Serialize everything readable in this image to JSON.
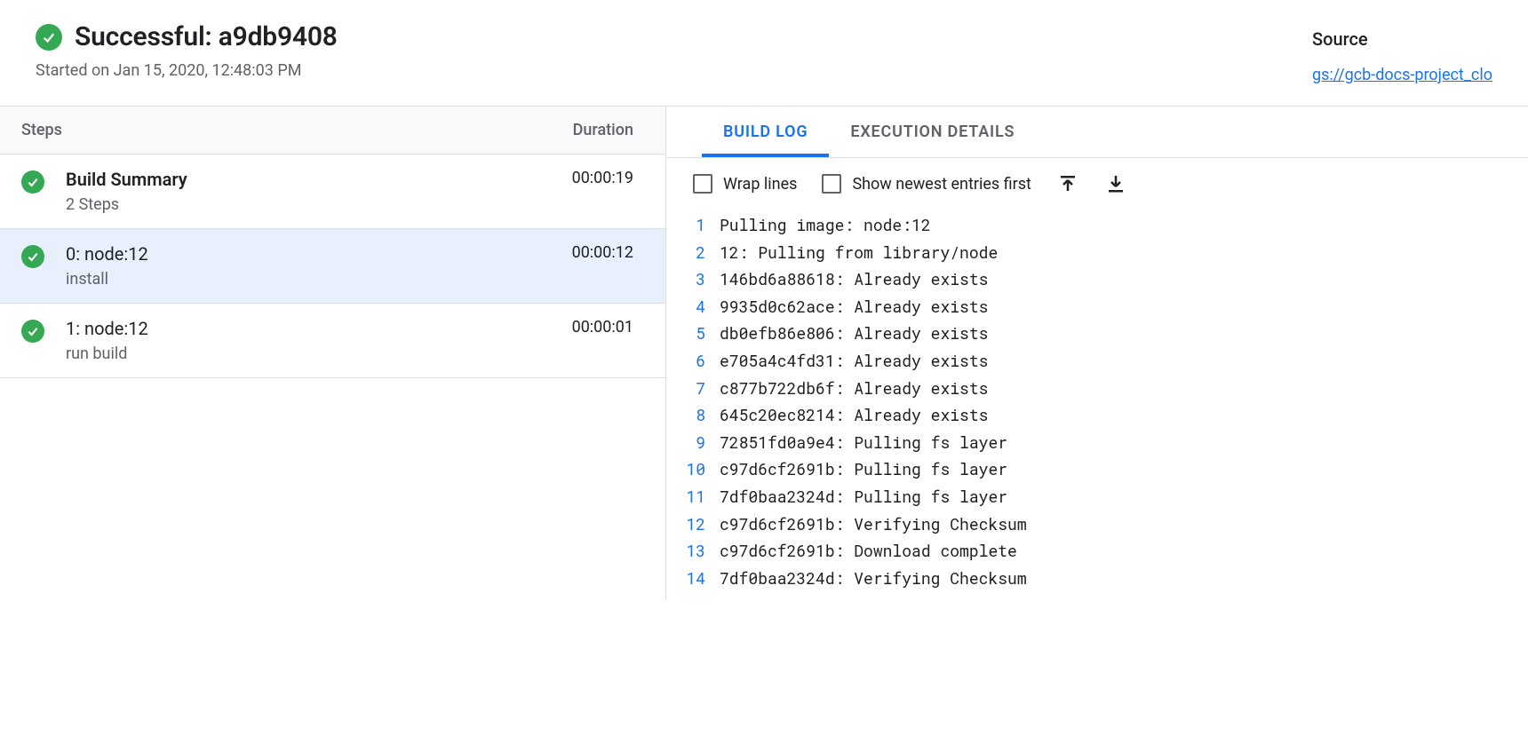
{
  "header": {
    "status": "Successful",
    "build_id": "a9db9408",
    "title": "Successful: a9db9408",
    "started": "Started on Jan 15, 2020, 12:48:03 PM"
  },
  "source": {
    "label": "Source",
    "link": "gs://gcb-docs-project_clo"
  },
  "steps_header": {
    "steps": "Steps",
    "duration": "Duration"
  },
  "summary": {
    "title": "Build Summary",
    "sub": "2 Steps",
    "duration": "00:00:19"
  },
  "steps": [
    {
      "title": "0: node:12",
      "sub": "install",
      "duration": "00:00:12",
      "selected": true
    },
    {
      "title": "1: node:12",
      "sub": "run build",
      "duration": "00:00:01",
      "selected": false
    }
  ],
  "tabs": {
    "build_log": "BUILD LOG",
    "execution_details": "EXECUTION DETAILS",
    "active": "build_log"
  },
  "toolbar": {
    "wrap_lines": "Wrap lines",
    "newest_first": "Show newest entries first"
  },
  "log": [
    "Pulling image: node:12",
    "12: Pulling from library/node",
    "146bd6a88618: Already exists",
    "9935d0c62ace: Already exists",
    "db0efb86e806: Already exists",
    "e705a4c4fd31: Already exists",
    "c877b722db6f: Already exists",
    "645c20ec8214: Already exists",
    "72851fd0a9e4: Pulling fs layer",
    "c97d6cf2691b: Pulling fs layer",
    "7df0baa2324d: Pulling fs layer",
    "c97d6cf2691b: Verifying Checksum",
    "c97d6cf2691b: Download complete",
    "7df0baa2324d: Verifying Checksum"
  ]
}
